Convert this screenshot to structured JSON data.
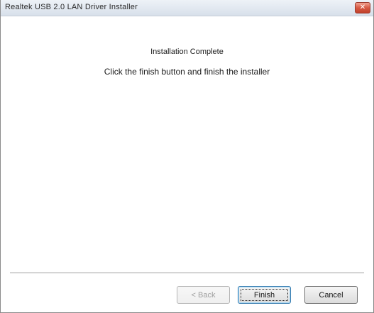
{
  "window": {
    "title": "Realtek USB 2.0 LAN Driver Installer",
    "close_icon": "close-icon"
  },
  "content": {
    "heading": "Installation Complete",
    "instruction": "Click the finish button and finish the installer"
  },
  "buttons": {
    "back_label": "< Back",
    "finish_label": "Finish",
    "cancel_label": "Cancel"
  },
  "colors": {
    "close_button": "#d75a44",
    "disabled_text": "#a0a0a0",
    "default_button_border": "#3c7fb1"
  }
}
